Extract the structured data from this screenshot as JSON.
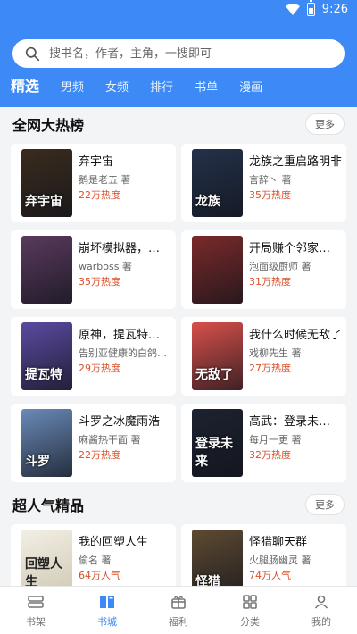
{
  "status": {
    "time": "9:26"
  },
  "search": {
    "placeholder": "搜书名，作者，主角，一搜即可"
  },
  "tabs": [
    "精选",
    "男频",
    "女频",
    "排行",
    "书单",
    "漫画"
  ],
  "sections": [
    {
      "title": "全网大热榜",
      "more": "更多",
      "books": [
        {
          "title": "弃宇宙",
          "author": "鹅是老五 著",
          "heat": "22万热度",
          "cover_text": "弃宇宙",
          "cover_color": "#3a2c1e"
        },
        {
          "title": "龙族之重启路明非",
          "author": "言辞丶 著",
          "heat": "35万热度",
          "cover_text": "龙族",
          "cover_color": "#24314a"
        },
        {
          "title": "崩坏模拟器，你找...",
          "author": "warboss 著",
          "heat": "35万热度",
          "cover_text": "",
          "cover_color": "#5a3a5e"
        },
        {
          "title": "开局赚个邻家小姐...",
          "author": "泡面级厨师 著",
          "heat": "31万热度",
          "cover_text": "",
          "cover_color": "#7a2a2a"
        },
        {
          "title": "原神，提瓦特全慌...",
          "author": "告别亚健康的白鸽酱 著",
          "heat": "29万热度",
          "cover_text": "提瓦特",
          "cover_color": "#5b4aa0"
        },
        {
          "title": "我什么时候无敌了",
          "author": "戏柳先生 著",
          "heat": "27万热度",
          "cover_text": "无敌了",
          "cover_color": "#d8504a"
        },
        {
          "title": "斗罗之冰魔雨浩",
          "author": "麻酱热干面 著",
          "heat": "22万热度",
          "cover_text": "斗罗",
          "cover_color": "#6a8ab8"
        },
        {
          "title": "高武：登录未来一...",
          "author": "每月一更 著",
          "heat": "32万热度",
          "cover_text": "登录未来",
          "cover_color": "#1d2230"
        }
      ]
    },
    {
      "title": "超人气精品",
      "more": "更多",
      "books": [
        {
          "title": "我的回塑人生",
          "author": "偷名 著",
          "heat": "64万人气",
          "cover_text": "回塑人生",
          "cover_color": "#e8e4d8"
        },
        {
          "title": "怪猎聊天群",
          "author": "火腿肠幽灵 著",
          "heat": "74万人气",
          "cover_text": "怪猎",
          "cover_color": "#5e4a32"
        }
      ]
    }
  ],
  "bottom_nav": [
    {
      "label": "书架",
      "icon": "bookshelf-icon"
    },
    {
      "label": "书城",
      "icon": "bookstore-icon",
      "active": true
    },
    {
      "label": "福利",
      "icon": "gift-icon"
    },
    {
      "label": "分类",
      "icon": "category-icon"
    },
    {
      "label": "我的",
      "icon": "user-icon"
    }
  ],
  "colors": {
    "accent": "#3d8af7",
    "heat": "#d9502a",
    "background": "#f3f4f6"
  }
}
